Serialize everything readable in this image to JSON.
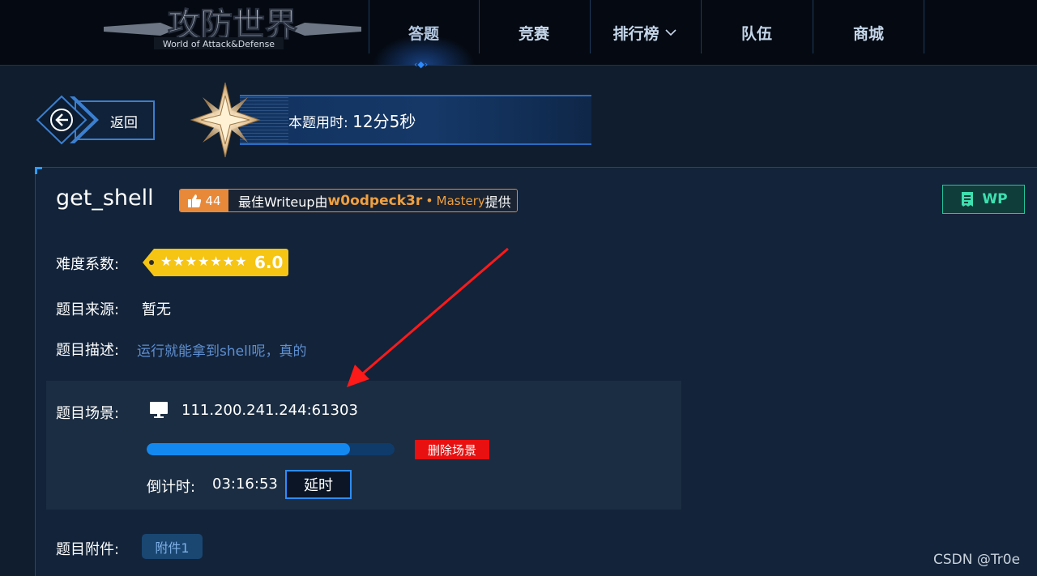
{
  "logo": {
    "main": "攻防世界",
    "sub": "World of Attack&Defense"
  },
  "nav": {
    "items": [
      {
        "label": "答题",
        "active": true
      },
      {
        "label": "竞赛"
      },
      {
        "label": "排行榜",
        "has_dropdown": true
      },
      {
        "label": "队伍"
      },
      {
        "label": "商城"
      }
    ]
  },
  "back": {
    "label": "返回"
  },
  "timer": {
    "label": "本题用时:",
    "value": "12分5秒"
  },
  "challenge": {
    "title": "get_shell",
    "likes": "44",
    "writeup_prefix": "最佳Writeup由",
    "writeup_author": "w0odpeck3r",
    "writeup_dot": "•",
    "writeup_rank": "Mastery",
    "writeup_suffix": "提供",
    "wp_label": "WP",
    "difficulty_label": "难度系数:",
    "difficulty_stars": "★★★★★★★",
    "difficulty_value": "6.0",
    "source_label": "题目来源:",
    "source_value": "暂无",
    "desc_label": "题目描述:",
    "desc_value": "运行就能拿到shell呢，真的",
    "scene_label": "题目场景:",
    "scene_address": "111.200.241.244:61303",
    "scene_progress": 0.82,
    "delete_label": "删除场景",
    "countdown_label": "倒计时:",
    "countdown_value": "03:16:53",
    "extend_label": "延时",
    "attach_label": "题目附件:",
    "attach_button": "附件1"
  },
  "watermark": "CSDN @Tr0e",
  "colors": {
    "accent": "#2d8cff",
    "danger": "#e81010",
    "gold": "#f6c513",
    "wp": "#3ee0b0",
    "like": "#e8893a"
  }
}
